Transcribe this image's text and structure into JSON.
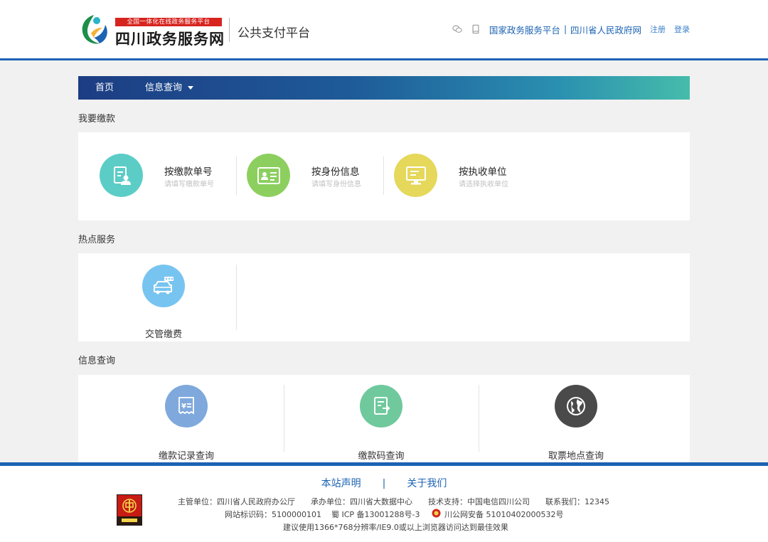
{
  "header": {
    "logo_banner": "全国一体化在线政务服务平台",
    "logo_name": "四川政务服务网",
    "platform_title": "公共支付平台",
    "links": {
      "national": "国家政务服务平台",
      "separator": "|",
      "province": "四川省人民政府网",
      "register": "注册",
      "login": "登录"
    },
    "icons": [
      "wechat-icon",
      "mobile-icon"
    ]
  },
  "nav": {
    "home": "首页",
    "info_query": "信息查询"
  },
  "sections": {
    "pay": "我要缴款",
    "hot": "热点服务",
    "info": "信息查询"
  },
  "pay_options": [
    {
      "label": "按缴款单号",
      "sub": "请填写缴款单号",
      "icon": "payer-document-icon",
      "color": "#5ccdc6"
    },
    {
      "label": "按身份信息",
      "sub": "请填写身份信息",
      "icon": "id-card-icon",
      "color": "#8ccf5f"
    },
    {
      "label": "按执收单位",
      "sub": "请选择执收单位",
      "icon": "monitor-icon",
      "color": "#e5d85a"
    }
  ],
  "hot_services": [
    {
      "label": "交管缴费",
      "icon": "traffic-car-icon",
      "color": "#78c4f0"
    }
  ],
  "info_queries": [
    {
      "label": "缴款记录查询",
      "icon": "receipt-icon",
      "color": "#7fa9dc"
    },
    {
      "label": "缴款码查询",
      "icon": "code-document-icon",
      "color": "#6fc99d"
    },
    {
      "label": "取票地点查询",
      "icon": "globe-icon",
      "color": "#4a4a4a"
    }
  ],
  "footer": {
    "statement": "本站声明",
    "separator": "|",
    "about": "关于我们",
    "line1": "主管单位：四川省人民政府办公厅　　承办单位：四川省大数据中心　　技术支持：中国电信四川公司　　联系我们：12345",
    "site_id": "网站标识码：5100000101",
    "icp": "蜀 ICP 备13001288号-3",
    "police": "川公网安备 51010402000532号",
    "line3": "建议使用1366*768分辨率/IE9.0或以上浏览器访问达到最佳效果"
  }
}
